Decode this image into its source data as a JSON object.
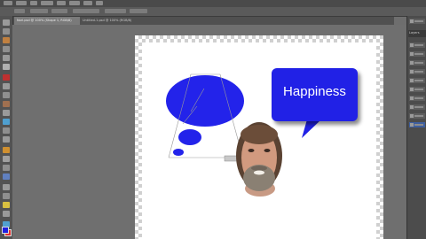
{
  "tabs": [
    {
      "label": "Nori.psd @ 100% (Shape 1, RGB/8)"
    },
    {
      "label": "Untitled-1.psd @ 100% (RGB/8)"
    }
  ],
  "canvas": {
    "speech_text": "Happiness",
    "bubble_color": "#2121e6"
  },
  "panel": {
    "title": "Layers"
  }
}
